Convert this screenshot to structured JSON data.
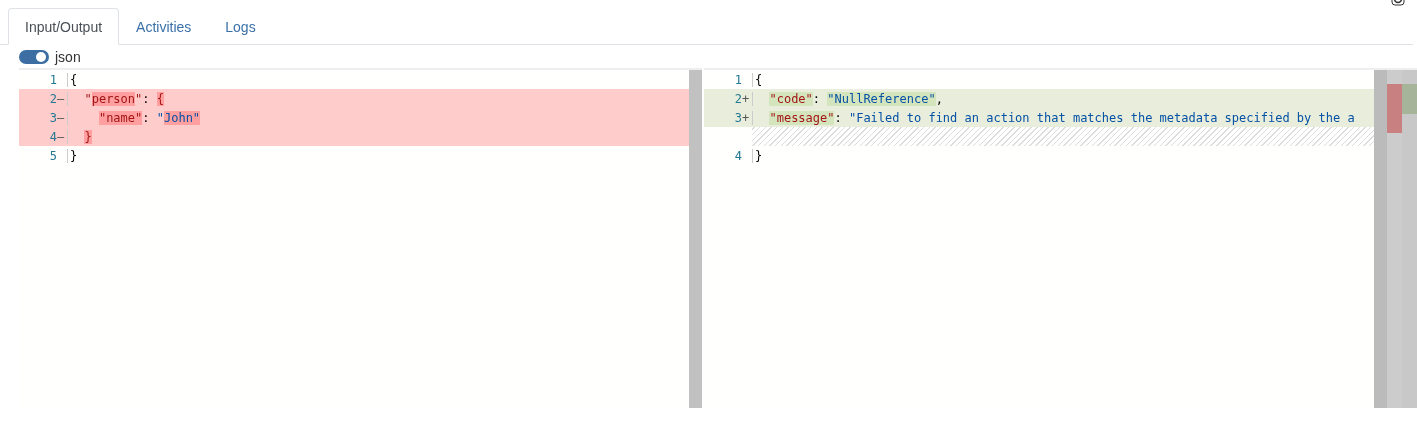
{
  "tabs": [
    {
      "label": "Input/Output",
      "selected": true
    },
    {
      "label": "Activities",
      "selected": false
    },
    {
      "label": "Logs",
      "selected": false
    }
  ],
  "format_toggle": {
    "label": "json",
    "on": true
  },
  "diff": {
    "left": [
      {
        "number": "1",
        "kind": "normal",
        "tokens": [
          {
            "kind": "punct",
            "text": "{",
            "changed": false
          }
        ]
      },
      {
        "number": "2",
        "kind": "removed",
        "marker": "—",
        "tokens": [
          {
            "kind": "key",
            "text": "  \"",
            "changed": false
          },
          {
            "kind": "key",
            "text": "person",
            "changed": true
          },
          {
            "kind": "key",
            "text": "\"",
            "changed": false
          },
          {
            "kind": "punct",
            "text": ": ",
            "changed": false
          },
          {
            "kind": "key",
            "text": "{",
            "changed": true
          }
        ]
      },
      {
        "number": "3",
        "kind": "removed",
        "marker": "—",
        "tokens": [
          {
            "kind": "key",
            "text": "    \"name\"",
            "changed": true
          },
          {
            "kind": "punct",
            "text": ": ",
            "changed": false
          },
          {
            "kind": "string",
            "text": "\"",
            "changed": false
          },
          {
            "kind": "string",
            "text": "John\"",
            "changed": true
          }
        ]
      },
      {
        "number": "4",
        "kind": "removed",
        "marker": "—",
        "tokens": [
          {
            "kind": "key",
            "text": "  }",
            "changed": true
          }
        ]
      },
      {
        "number": "5",
        "kind": "normal",
        "tokens": [
          {
            "kind": "punct",
            "text": "}",
            "changed": false
          }
        ]
      }
    ],
    "right": [
      {
        "number": "1",
        "kind": "normal",
        "tokens": [
          {
            "kind": "punct",
            "text": "{",
            "changed": false
          }
        ]
      },
      {
        "number": "2",
        "kind": "added",
        "marker": "+",
        "tokens": [
          {
            "kind": "key",
            "text": "  \"code\"",
            "changed": true
          },
          {
            "kind": "punct",
            "text": ": ",
            "changed": false
          },
          {
            "kind": "string",
            "text": "\"NullReference\"",
            "changed": true
          },
          {
            "kind": "punct",
            "text": ",",
            "changed": false
          }
        ]
      },
      {
        "number": "3",
        "kind": "added",
        "marker": "+",
        "tokens": [
          {
            "kind": "key",
            "text": "  \"message\"",
            "changed": true
          },
          {
            "kind": "punct",
            "text": ": ",
            "changed": false
          },
          {
            "kind": "string",
            "text": "\"Failed to find an action that matches the metadata specified by the a",
            "changed": false
          }
        ]
      },
      {
        "kind": "placeholder"
      },
      {
        "number": "4",
        "kind": "normal",
        "tokens": [
          {
            "kind": "punct",
            "text": "}",
            "changed": false
          }
        ]
      }
    ]
  }
}
